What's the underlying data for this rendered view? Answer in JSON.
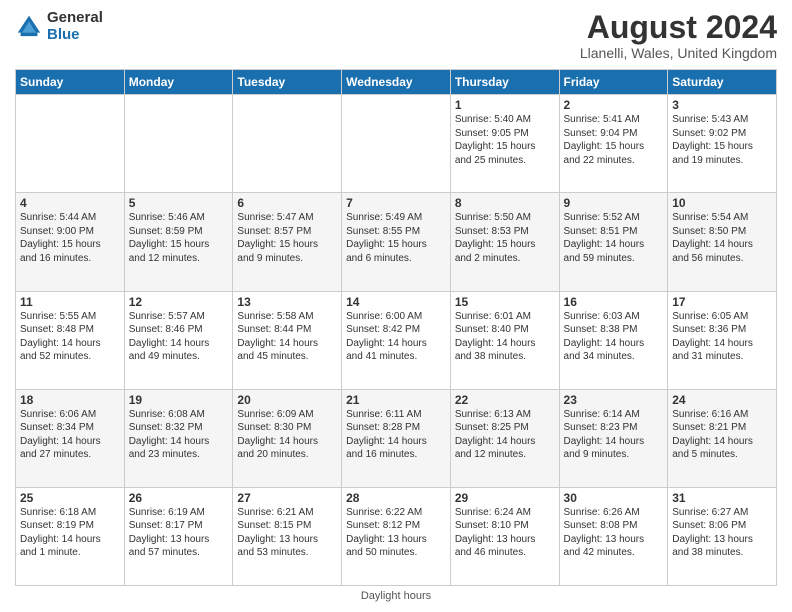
{
  "header": {
    "logo_general": "General",
    "logo_blue": "Blue",
    "month_year": "August 2024",
    "location": "Llanelli, Wales, United Kingdom"
  },
  "calendar": {
    "days_of_week": [
      "Sunday",
      "Monday",
      "Tuesday",
      "Wednesday",
      "Thursday",
      "Friday",
      "Saturday"
    ],
    "weeks": [
      [
        {
          "day": "",
          "sunrise": "",
          "sunset": "",
          "daylight": ""
        },
        {
          "day": "",
          "sunrise": "",
          "sunset": "",
          "daylight": ""
        },
        {
          "day": "",
          "sunrise": "",
          "sunset": "",
          "daylight": ""
        },
        {
          "day": "",
          "sunrise": "",
          "sunset": "",
          "daylight": ""
        },
        {
          "day": "1",
          "sunrise": "Sunrise: 5:40 AM",
          "sunset": "Sunset: 9:05 PM",
          "daylight": "Daylight: 15 hours and 25 minutes."
        },
        {
          "day": "2",
          "sunrise": "Sunrise: 5:41 AM",
          "sunset": "Sunset: 9:04 PM",
          "daylight": "Daylight: 15 hours and 22 minutes."
        },
        {
          "day": "3",
          "sunrise": "Sunrise: 5:43 AM",
          "sunset": "Sunset: 9:02 PM",
          "daylight": "Daylight: 15 hours and 19 minutes."
        }
      ],
      [
        {
          "day": "4",
          "sunrise": "Sunrise: 5:44 AM",
          "sunset": "Sunset: 9:00 PM",
          "daylight": "Daylight: 15 hours and 16 minutes."
        },
        {
          "day": "5",
          "sunrise": "Sunrise: 5:46 AM",
          "sunset": "Sunset: 8:59 PM",
          "daylight": "Daylight: 15 hours and 12 minutes."
        },
        {
          "day": "6",
          "sunrise": "Sunrise: 5:47 AM",
          "sunset": "Sunset: 8:57 PM",
          "daylight": "Daylight: 15 hours and 9 minutes."
        },
        {
          "day": "7",
          "sunrise": "Sunrise: 5:49 AM",
          "sunset": "Sunset: 8:55 PM",
          "daylight": "Daylight: 15 hours and 6 minutes."
        },
        {
          "day": "8",
          "sunrise": "Sunrise: 5:50 AM",
          "sunset": "Sunset: 8:53 PM",
          "daylight": "Daylight: 15 hours and 2 minutes."
        },
        {
          "day": "9",
          "sunrise": "Sunrise: 5:52 AM",
          "sunset": "Sunset: 8:51 PM",
          "daylight": "Daylight: 14 hours and 59 minutes."
        },
        {
          "day": "10",
          "sunrise": "Sunrise: 5:54 AM",
          "sunset": "Sunset: 8:50 PM",
          "daylight": "Daylight: 14 hours and 56 minutes."
        }
      ],
      [
        {
          "day": "11",
          "sunrise": "Sunrise: 5:55 AM",
          "sunset": "Sunset: 8:48 PM",
          "daylight": "Daylight: 14 hours and 52 minutes."
        },
        {
          "day": "12",
          "sunrise": "Sunrise: 5:57 AM",
          "sunset": "Sunset: 8:46 PM",
          "daylight": "Daylight: 14 hours and 49 minutes."
        },
        {
          "day": "13",
          "sunrise": "Sunrise: 5:58 AM",
          "sunset": "Sunset: 8:44 PM",
          "daylight": "Daylight: 14 hours and 45 minutes."
        },
        {
          "day": "14",
          "sunrise": "Sunrise: 6:00 AM",
          "sunset": "Sunset: 8:42 PM",
          "daylight": "Daylight: 14 hours and 41 minutes."
        },
        {
          "day": "15",
          "sunrise": "Sunrise: 6:01 AM",
          "sunset": "Sunset: 8:40 PM",
          "daylight": "Daylight: 14 hours and 38 minutes."
        },
        {
          "day": "16",
          "sunrise": "Sunrise: 6:03 AM",
          "sunset": "Sunset: 8:38 PM",
          "daylight": "Daylight: 14 hours and 34 minutes."
        },
        {
          "day": "17",
          "sunrise": "Sunrise: 6:05 AM",
          "sunset": "Sunset: 8:36 PM",
          "daylight": "Daylight: 14 hours and 31 minutes."
        }
      ],
      [
        {
          "day": "18",
          "sunrise": "Sunrise: 6:06 AM",
          "sunset": "Sunset: 8:34 PM",
          "daylight": "Daylight: 14 hours and 27 minutes."
        },
        {
          "day": "19",
          "sunrise": "Sunrise: 6:08 AM",
          "sunset": "Sunset: 8:32 PM",
          "daylight": "Daylight: 14 hours and 23 minutes."
        },
        {
          "day": "20",
          "sunrise": "Sunrise: 6:09 AM",
          "sunset": "Sunset: 8:30 PM",
          "daylight": "Daylight: 14 hours and 20 minutes."
        },
        {
          "day": "21",
          "sunrise": "Sunrise: 6:11 AM",
          "sunset": "Sunset: 8:28 PM",
          "daylight": "Daylight: 14 hours and 16 minutes."
        },
        {
          "day": "22",
          "sunrise": "Sunrise: 6:13 AM",
          "sunset": "Sunset: 8:25 PM",
          "daylight": "Daylight: 14 hours and 12 minutes."
        },
        {
          "day": "23",
          "sunrise": "Sunrise: 6:14 AM",
          "sunset": "Sunset: 8:23 PM",
          "daylight": "Daylight: 14 hours and 9 minutes."
        },
        {
          "day": "24",
          "sunrise": "Sunrise: 6:16 AM",
          "sunset": "Sunset: 8:21 PM",
          "daylight": "Daylight: 14 hours and 5 minutes."
        }
      ],
      [
        {
          "day": "25",
          "sunrise": "Sunrise: 6:18 AM",
          "sunset": "Sunset: 8:19 PM",
          "daylight": "Daylight: 14 hours and 1 minute."
        },
        {
          "day": "26",
          "sunrise": "Sunrise: 6:19 AM",
          "sunset": "Sunset: 8:17 PM",
          "daylight": "Daylight: 13 hours and 57 minutes."
        },
        {
          "day": "27",
          "sunrise": "Sunrise: 6:21 AM",
          "sunset": "Sunset: 8:15 PM",
          "daylight": "Daylight: 13 hours and 53 minutes."
        },
        {
          "day": "28",
          "sunrise": "Sunrise: 6:22 AM",
          "sunset": "Sunset: 8:12 PM",
          "daylight": "Daylight: 13 hours and 50 minutes."
        },
        {
          "day": "29",
          "sunrise": "Sunrise: 6:24 AM",
          "sunset": "Sunset: 8:10 PM",
          "daylight": "Daylight: 13 hours and 46 minutes."
        },
        {
          "day": "30",
          "sunrise": "Sunrise: 6:26 AM",
          "sunset": "Sunset: 8:08 PM",
          "daylight": "Daylight: 13 hours and 42 minutes."
        },
        {
          "day": "31",
          "sunrise": "Sunrise: 6:27 AM",
          "sunset": "Sunset: 8:06 PM",
          "daylight": "Daylight: 13 hours and 38 minutes."
        }
      ]
    ]
  },
  "footer": {
    "text": "Daylight hours"
  }
}
